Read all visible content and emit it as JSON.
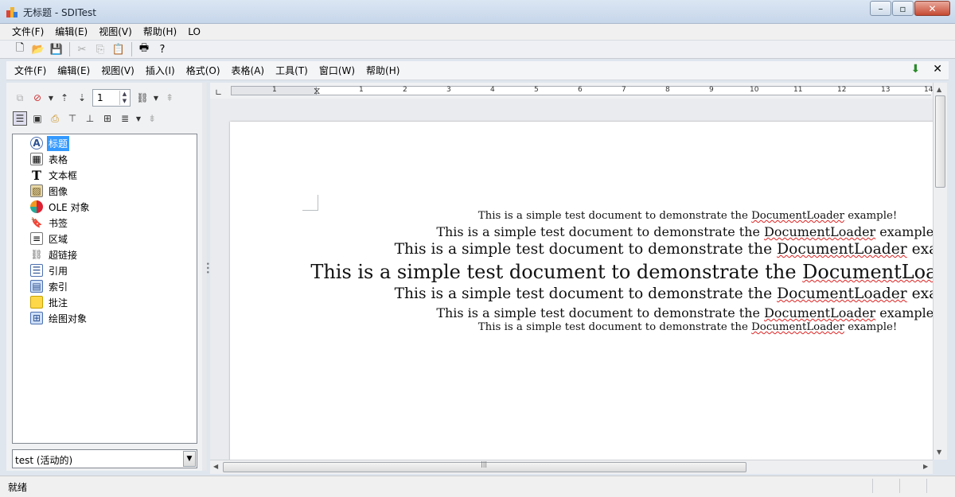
{
  "window": {
    "title": "无标题 - SDITest"
  },
  "menubar": [
    "文件(F)",
    "编辑(E)",
    "视图(V)",
    "帮助(H)",
    "LO"
  ],
  "lo_menu": [
    "文件(F)",
    "编辑(E)",
    "视图(V)",
    "插入(I)",
    "格式(O)",
    "表格(A)",
    "工具(T)",
    "窗口(W)",
    "帮助(H)"
  ],
  "navigator": {
    "page_value": "1",
    "items": [
      "标题",
      "表格",
      "文本框",
      "图像",
      "OLE 对象",
      "书签",
      "区域",
      "超链接",
      "引用",
      "索引",
      "批注",
      "绘图对象"
    ],
    "selected": "标题",
    "document_combo": "test (活动的)"
  },
  "ruler": {
    "numbers": [
      "1",
      "1",
      "2",
      "3",
      "4",
      "5",
      "6",
      "7",
      "8",
      "9",
      "10",
      "11",
      "12",
      "13",
      "14"
    ]
  },
  "document": {
    "line_prefix": "This is a simple test document to demonstrate the ",
    "line_word": "DocumentLoader",
    "line_suffix": " example!",
    "font_sizes_pt": [
      10,
      12,
      14,
      18,
      14,
      12,
      10
    ]
  },
  "statusbar": {
    "text": "就绪"
  },
  "colors": {
    "selection": "#3399ff",
    "spellcheck": "#dd2222"
  }
}
